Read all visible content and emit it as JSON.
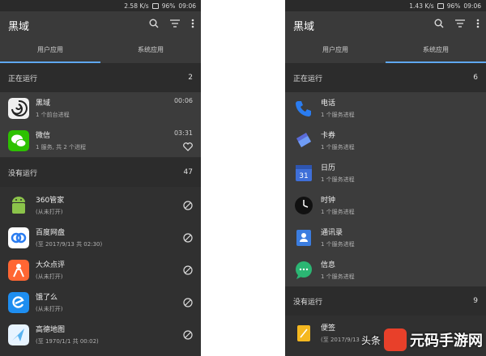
{
  "left": {
    "status": {
      "speed": "2.58 K/s",
      "battery": "96%",
      "time": "09:06"
    },
    "title": "黑域",
    "tabs": [
      {
        "label": "用户应用",
        "active": true
      },
      {
        "label": "系统应用",
        "active": false
      }
    ],
    "running_header": {
      "label": "正在运行",
      "count": "2"
    },
    "running": [
      {
        "name": "黑域",
        "sub": "1 个前台进程",
        "time": "00:06",
        "icon": "blackhole-icon",
        "color": "#f0f0f0"
      },
      {
        "name": "微信",
        "sub": "1 服务, 共 2 个进程",
        "time": "03:31",
        "icon": "wechat-icon",
        "color": "#2dc100"
      }
    ],
    "stopped_header": {
      "label": "没有运行",
      "count": "47"
    },
    "stopped": [
      {
        "name": "360管家",
        "sub": "(从未打开)",
        "icon": "android-icon",
        "color": "#8bc34a"
      },
      {
        "name": "百度网盘",
        "sub": "(至 2017/9/13 共 02:30)",
        "icon": "baidu-pan-icon",
        "color": "#2a7cf0"
      },
      {
        "name": "大众点评",
        "sub": "(从未打开)",
        "icon": "dianping-icon",
        "color": "#ff6633"
      },
      {
        "name": "饿了么",
        "sub": "(从未打开)",
        "icon": "eleme-icon",
        "color": "#1e8ef0"
      },
      {
        "name": "高德地图",
        "sub": "(至 1970/1/1 共 00:02)",
        "icon": "amap-icon",
        "color": "#5ab4f0"
      }
    ]
  },
  "right": {
    "status": {
      "speed": "1.43 K/s",
      "battery": "96%",
      "time": "09:06"
    },
    "title": "黑域",
    "tabs": [
      {
        "label": "用户应用",
        "active": false
      },
      {
        "label": "系统应用",
        "active": true
      }
    ],
    "running_header": {
      "label": "正在运行",
      "count": "6"
    },
    "running": [
      {
        "name": "电话",
        "sub": "1 个服务进程",
        "icon": "phone-icon",
        "color": "#2a7cf0"
      },
      {
        "name": "卡券",
        "sub": "1 个服务进程",
        "icon": "wallet-icon",
        "color": "#5a6bd8"
      },
      {
        "name": "日历",
        "sub": "1 个服务进程",
        "icon": "calendar-icon",
        "color": "#3f6fd8"
      },
      {
        "name": "时钟",
        "sub": "1 个服务进程",
        "icon": "clock-icon",
        "color": "#111111"
      },
      {
        "name": "通讯录",
        "sub": "1 个服务进程",
        "icon": "contacts-icon",
        "color": "#3b7de0"
      },
      {
        "name": "信息",
        "sub": "1 个服务进程",
        "icon": "messages-icon",
        "color": "#2bb673"
      }
    ],
    "stopped_header": {
      "label": "没有运行",
      "count": "9"
    },
    "stopped": [
      {
        "name": "便签",
        "sub": "(至 2017/9/13",
        "icon": "notes-icon",
        "color": "#f5b820"
      }
    ]
  },
  "watermark": {
    "pre": "头条",
    "text": "元码手游网"
  },
  "colors": {
    "bg": "#303030",
    "accent": "#5fa8f0"
  }
}
